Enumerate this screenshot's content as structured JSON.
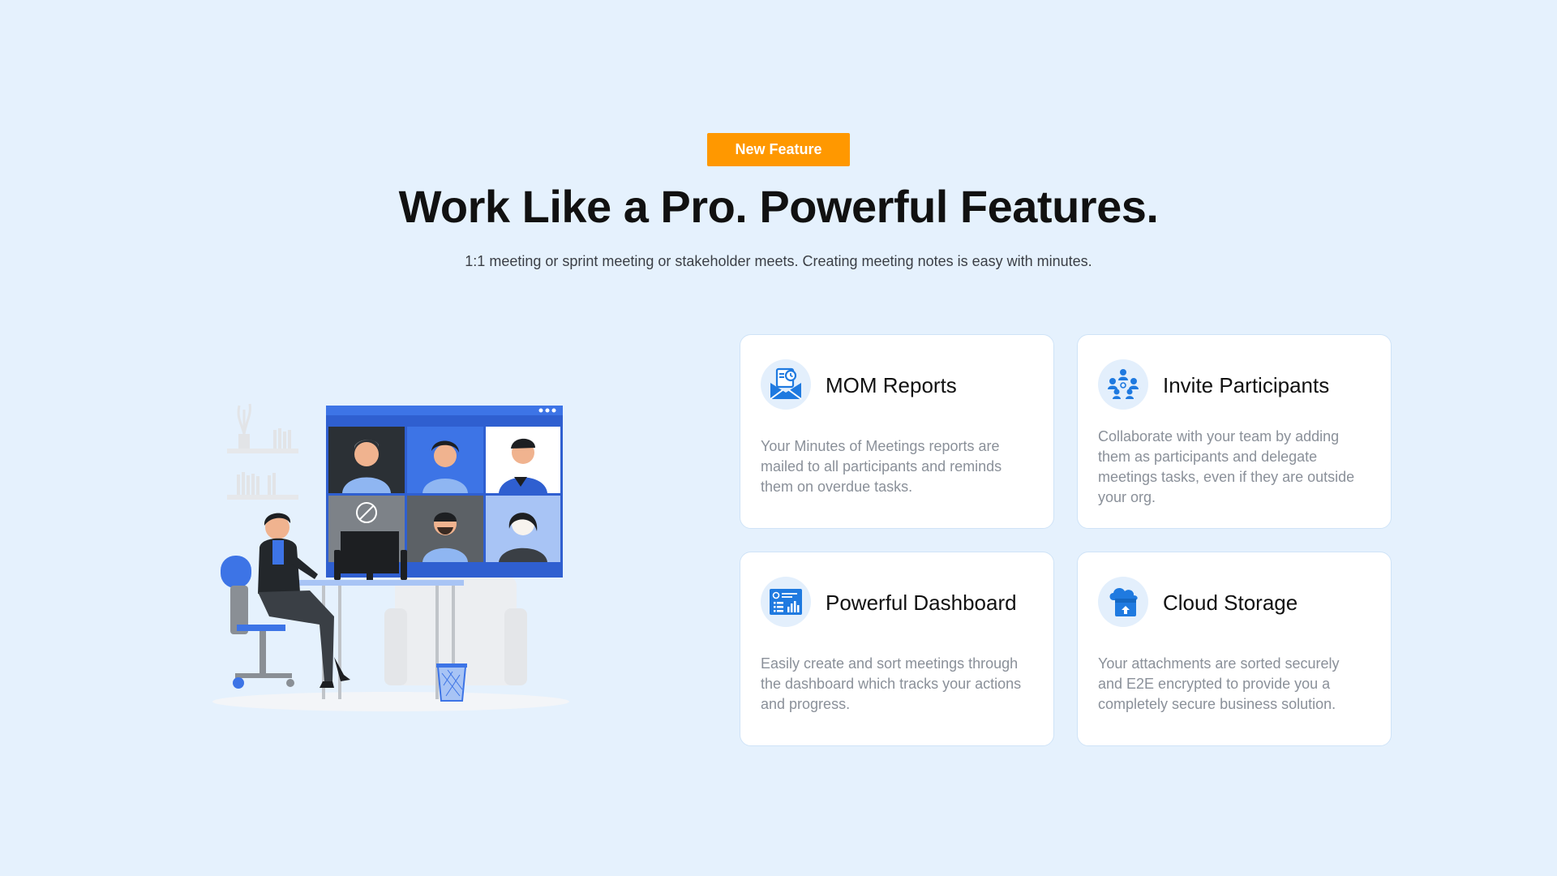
{
  "hero": {
    "badge": "New Feature",
    "title": "Work Like a Pro. Powerful Features.",
    "subtitle": "1:1 meeting or sprint meeting or stakeholder meets. Creating meeting notes is easy with minutes."
  },
  "features": [
    {
      "title": "MOM Reports",
      "description": "Your Minutes of Meetings reports are mailed to all participants and reminds them on overdue tasks.",
      "icon": "mail-report-icon"
    },
    {
      "title": "Invite Participants",
      "description": "Collaborate with your team by adding them as participants and delegate meetings tasks, even if they are outside your org.",
      "icon": "people-network-icon"
    },
    {
      "title": "Powerful Dashboard",
      "description": "Easily create and sort meetings through the dashboard which tracks your actions and progress.",
      "icon": "dashboard-icon"
    },
    {
      "title": "Cloud Storage",
      "description": "Your attachments are sorted securely and E2E encrypted to provide you a completely secure business solution.",
      "icon": "cloud-upload-icon"
    }
  ],
  "colors": {
    "background": "#e5f1fd",
    "accent": "#ff9800",
    "icon_blue": "#1f7ae0",
    "card_border": "#cfe3f7",
    "text_muted": "#8a9099"
  }
}
